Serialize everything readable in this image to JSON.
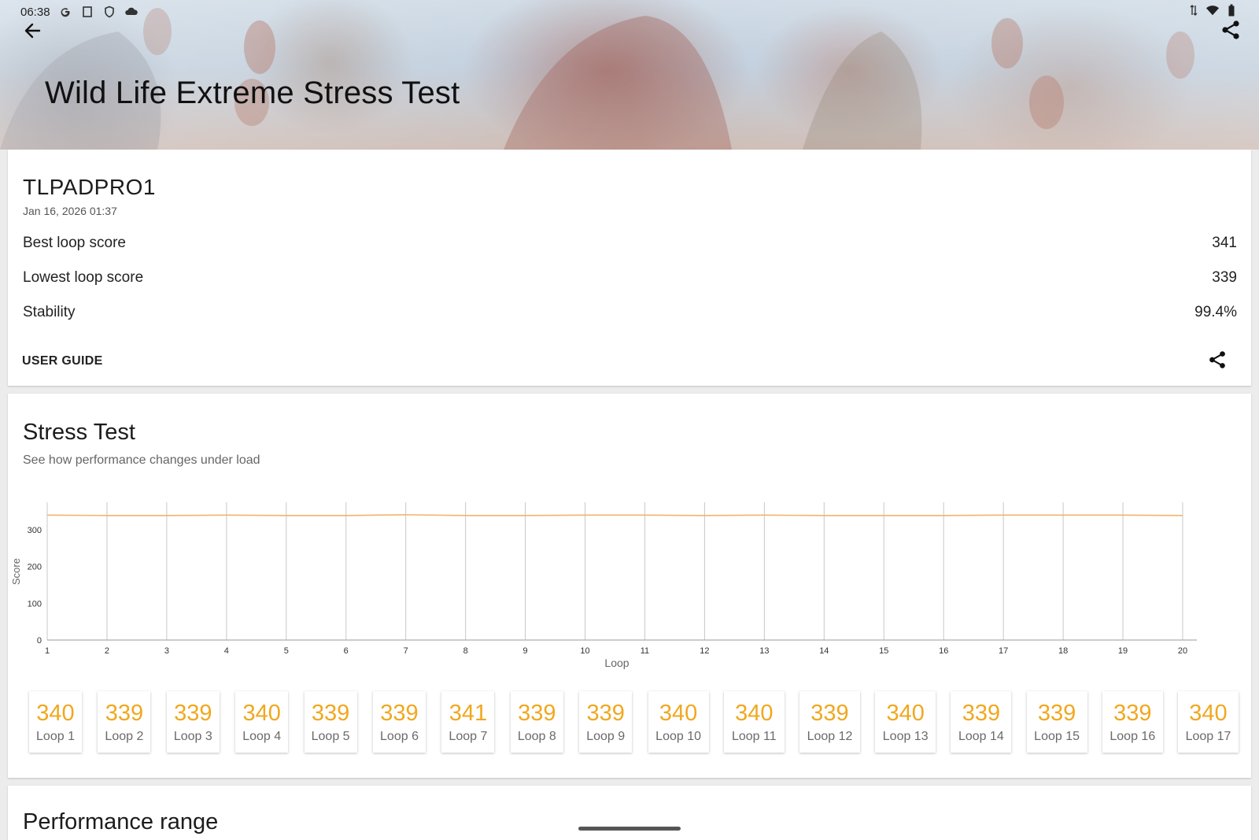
{
  "status_bar": {
    "time": "06:38",
    "left_icons": [
      "google-g-icon",
      "screenshot-icon",
      "shield-icon",
      "cloud-icon"
    ],
    "right_icons": [
      "data-transfer-icon",
      "wifi-icon",
      "battery-icon"
    ]
  },
  "header": {
    "title": "Wild Life Extreme Stress Test",
    "back_icon": "arrow-left-icon",
    "share_icon": "share-icon"
  },
  "summary": {
    "device_name": "TLPADPRO1",
    "date": "Jan 16, 2026 01:37",
    "metrics": [
      {
        "label": "Best loop score",
        "value": "341"
      },
      {
        "label": "Lowest loop score",
        "value": "339"
      },
      {
        "label": "Stability",
        "value": "99.4%"
      }
    ],
    "user_guide_label": "USER GUIDE"
  },
  "stress_test": {
    "title": "Stress Test",
    "subtitle": "See how performance changes under load"
  },
  "chart_data": {
    "type": "line",
    "x": [
      1,
      2,
      3,
      4,
      5,
      6,
      7,
      8,
      9,
      10,
      11,
      12,
      13,
      14,
      15,
      16,
      17,
      18,
      19,
      20
    ],
    "series": [
      {
        "values": [
          340,
          339,
          339,
          340,
          339,
          339,
          341,
          339,
          339,
          340,
          340,
          339,
          340,
          339,
          339,
          339,
          340,
          340,
          340,
          339
        ]
      }
    ],
    "xlabel": "Loop",
    "ylabel": "Score",
    "yticks": [
      0,
      100,
      200,
      300
    ],
    "ylim": [
      0,
      375
    ],
    "grid": "vertical",
    "line_color": "#f0b56a"
  },
  "loop_tiles": [
    {
      "score": "340",
      "label": "Loop 1"
    },
    {
      "score": "339",
      "label": "Loop 2"
    },
    {
      "score": "339",
      "label": "Loop 3"
    },
    {
      "score": "340",
      "label": "Loop 4"
    },
    {
      "score": "339",
      "label": "Loop 5"
    },
    {
      "score": "339",
      "label": "Loop 6"
    },
    {
      "score": "341",
      "label": "Loop 7"
    },
    {
      "score": "339",
      "label": "Loop 8"
    },
    {
      "score": "339",
      "label": "Loop 9"
    },
    {
      "score": "340",
      "label": "Loop 10"
    },
    {
      "score": "340",
      "label": "Loop 11"
    },
    {
      "score": "339",
      "label": "Loop 12"
    },
    {
      "score": "340",
      "label": "Loop 13"
    },
    {
      "score": "339",
      "label": "Loop 14"
    },
    {
      "score": "339",
      "label": "Loop 15"
    },
    {
      "score": "339",
      "label": "Loop 16"
    },
    {
      "score": "340",
      "label": "Loop 17"
    }
  ],
  "performance_range": {
    "title": "Performance range"
  },
  "colors": {
    "accent_orange": "#f0a81f",
    "chart_line": "#f0b56a"
  }
}
